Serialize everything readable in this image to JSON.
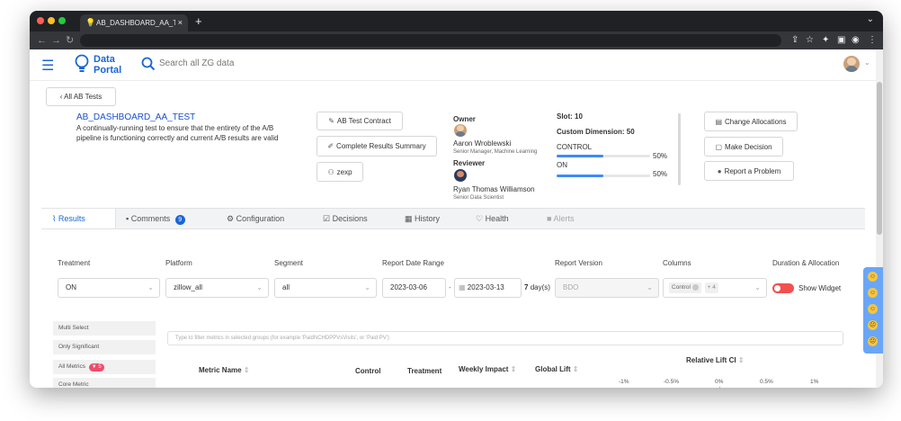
{
  "browser": {
    "tab_title": "AB_DASHBOARD_AA_TEST - ",
    "tab_close": "×",
    "new_tab": "+",
    "menu_chevron": "⌄"
  },
  "header": {
    "menu_icon": "☰",
    "logo_line1": "Data",
    "logo_line2": "Portal",
    "search_placeholder": "Search all ZG data"
  },
  "back_button": "‹ All AB Tests",
  "test": {
    "name": "AB_DASHBOARD_AA_TEST",
    "description": "A continually-running test to ensure that the entirety of the A/B pipeline is functioning correctly and current A/B results are valid"
  },
  "actions": {
    "contract": "AB Test Contract",
    "summary": "Complete Results Summary",
    "zexp": "zexp"
  },
  "people": {
    "owner_label": "Owner",
    "owner_name": "Aaron Wroblewski",
    "owner_title": "Senior Manager, Machine Learning",
    "reviewer_label": "Reviewer",
    "reviewer_name": "Ryan Thomas Williamson",
    "reviewer_title": "Senior Data Scientist"
  },
  "allocation": {
    "slot": "Slot: 10",
    "custom_dimension": "Custom Dimension: 50",
    "groups": [
      {
        "name": "CONTROL",
        "pct": "50%",
        "fill": 0.5
      },
      {
        "name": "ON",
        "pct": "50%",
        "fill": 0.5
      }
    ]
  },
  "right_actions": {
    "change": "Change Allocations",
    "decision": "Make Decision",
    "report": "Report a Problem"
  },
  "tabs": [
    {
      "label": "Results"
    },
    {
      "label": "Comments",
      "badge": "9"
    },
    {
      "label": "Configuration"
    },
    {
      "label": "Decisions"
    },
    {
      "label": "History"
    },
    {
      "label": "Health"
    },
    {
      "label": "Alerts"
    }
  ],
  "filters": {
    "treatment_label": "Treatment",
    "treatment_value": "ON",
    "platform_label": "Platform",
    "platform_value": "zillow_all",
    "segment_label": "Segment",
    "segment_value": "all",
    "date_label": "Report Date Range",
    "date_start": "2023-03-06",
    "date_sep": "-",
    "date_end": "2023-03-13",
    "days": "7",
    "days_unit": "day(s)",
    "version_label": "Report Version",
    "version_value": "BDO",
    "columns_label": "Columns",
    "columns_control": "Control",
    "columns_more": "+ 4",
    "duration_label": "Duration & Allocation",
    "show_widget": "Show Widget"
  },
  "sidebar": {
    "multi_select": "Multi Select",
    "only_significant": "Only Significant",
    "all_metrics": "All Metrics",
    "all_metrics_badge": "5",
    "core_metric": "Core Metric"
  },
  "metrics": {
    "filter_placeholder": "Type to filter metrics in selected groups (for example 'PaidNCHDPPVsVisits', or 'Paid PV')",
    "col_metric": "Metric Name",
    "col_control": "Control",
    "col_treatment": "Treatment",
    "col_weekly": "Weekly Impact",
    "col_global": "Global Lift",
    "col_ci": "Relative Lift CI",
    "ticks": [
      "-1%",
      "-0.5%",
      "0%",
      "0.5%",
      "1%"
    ]
  }
}
